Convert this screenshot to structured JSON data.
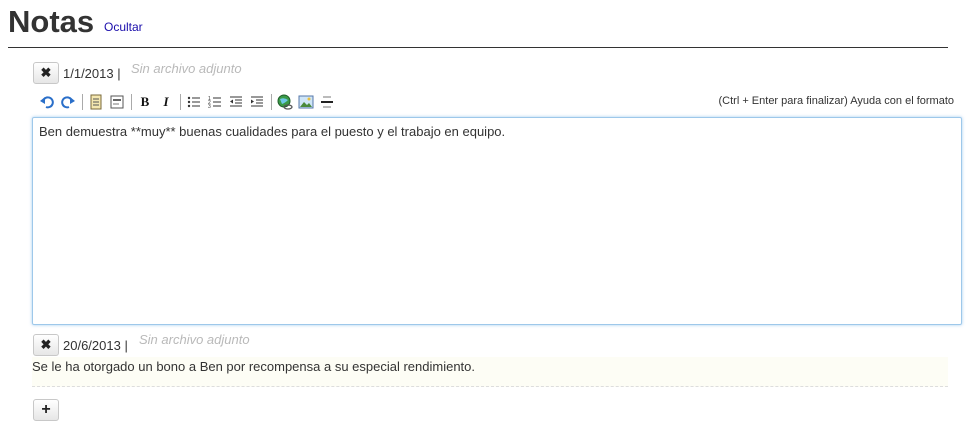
{
  "header": {
    "title": "Notas",
    "hide_label": "Ocultar"
  },
  "note1": {
    "date": "1/1/2013 |",
    "attachment": "Sin archivo adjunto",
    "editor_text": "Ben demuestra **muy** buenas cualidades para el puesto y el trabajo en equipo."
  },
  "toolbar": {
    "icons": [
      "undo-icon",
      "redo-icon",
      "paragraph-icon",
      "heading-icon",
      "bold-icon",
      "italic-icon",
      "bulleted-list-icon",
      "numbered-list-icon",
      "outdent-icon",
      "indent-icon",
      "link-icon",
      "image-icon",
      "horizontal-rule-icon"
    ],
    "help_text": "(Ctrl + Enter para finalizar) Ayuda con el formato"
  },
  "note2": {
    "date": "20/6/2013 |",
    "attachment": "Sin archivo adjunto",
    "text": "Se le ha otorgado un bono a Ben por recompensa a su especial rendimiento."
  },
  "buttons": {
    "delete_symbol": "✖",
    "add_symbol": "+"
  }
}
